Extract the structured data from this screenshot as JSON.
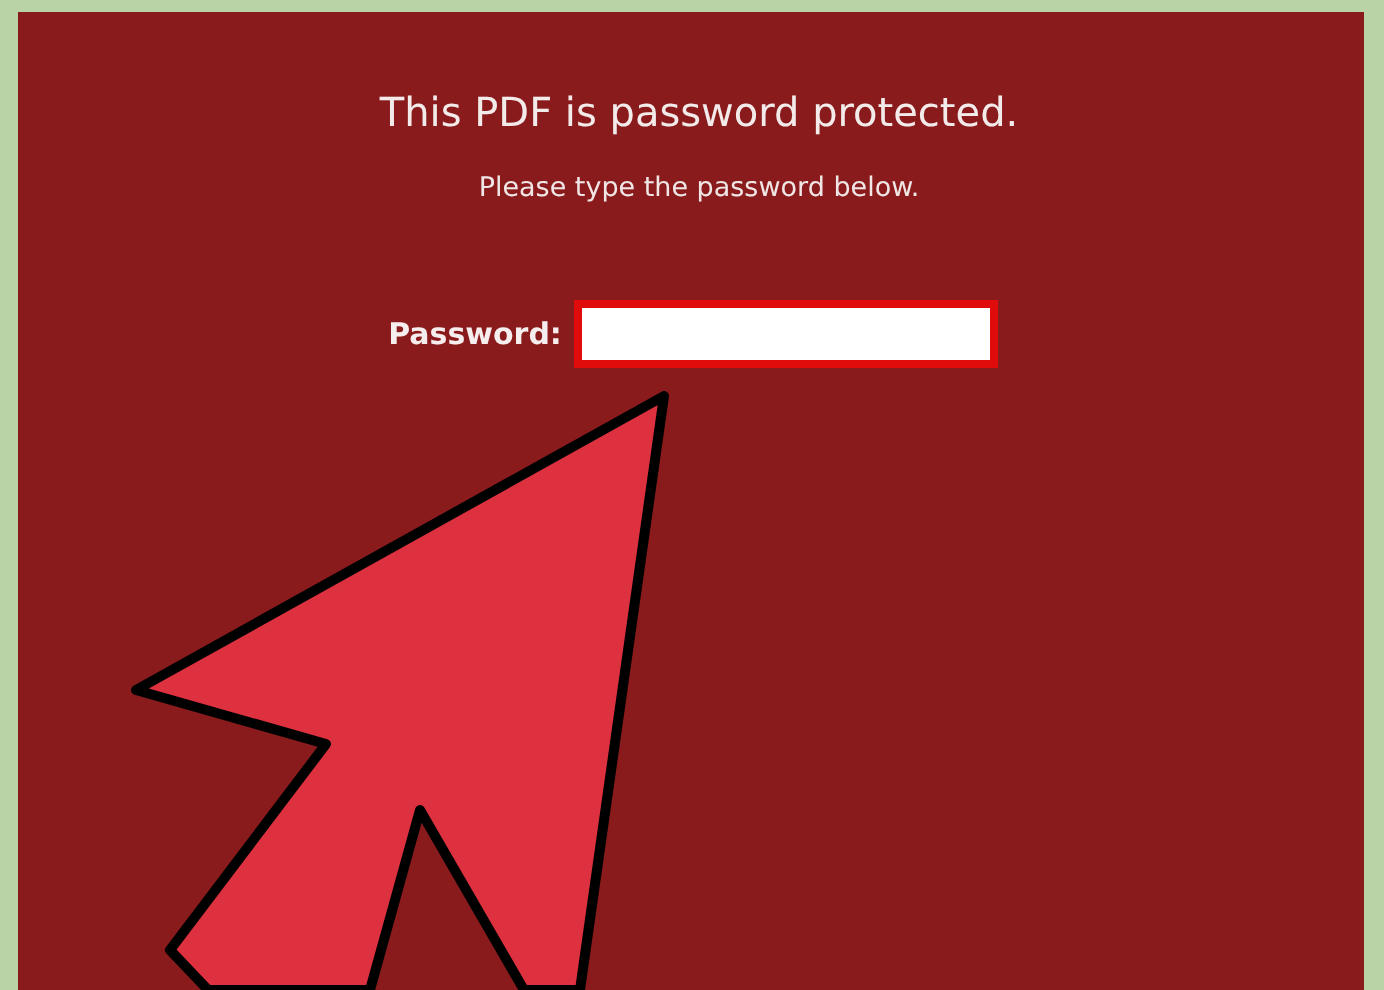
{
  "dialog": {
    "title": "This PDF is password protected.",
    "message": "Please type the password below.",
    "password_field": {
      "label": "Password:",
      "highlighted": true
    }
  },
  "annotation": {
    "kind": "arrow"
  }
}
